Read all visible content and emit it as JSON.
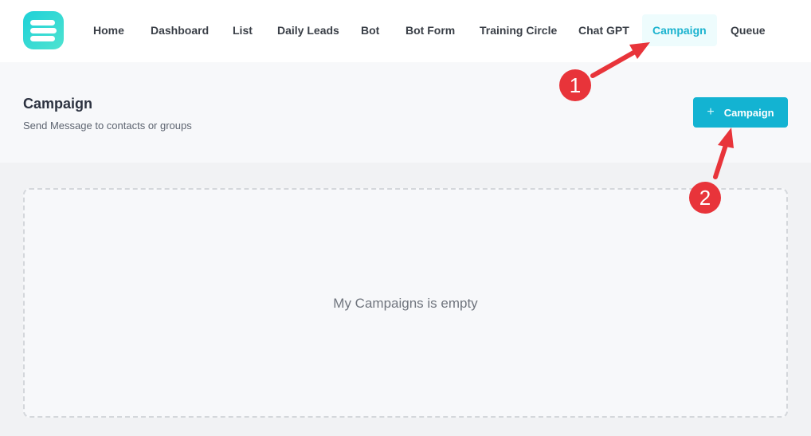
{
  "nav": {
    "items": [
      {
        "label": "Home"
      },
      {
        "label": "Dashboard"
      },
      {
        "label": "List"
      },
      {
        "label": "Daily Leads"
      },
      {
        "label": "Bot"
      },
      {
        "label": "Bot Form"
      },
      {
        "label": "Training Circle"
      },
      {
        "label": "Chat GPT"
      },
      {
        "label": "Campaign",
        "active": true
      },
      {
        "label": "Queue"
      }
    ]
  },
  "page": {
    "title": "Campaign",
    "subtitle": "Send Message to contacts or groups",
    "add_button_icon": "+",
    "add_button_label": "Campaign"
  },
  "empty_state": {
    "message": "My Campaigns is empty"
  },
  "annotations": {
    "step1": "1",
    "step2": "2"
  },
  "colors": {
    "accent": "#13b3d2",
    "active_nav_bg": "#eefcfd",
    "annotation_red": "#e8343a"
  },
  "icons": {
    "logo": "stacked-bars-logo",
    "annotation_arrow": "red-arrow"
  }
}
